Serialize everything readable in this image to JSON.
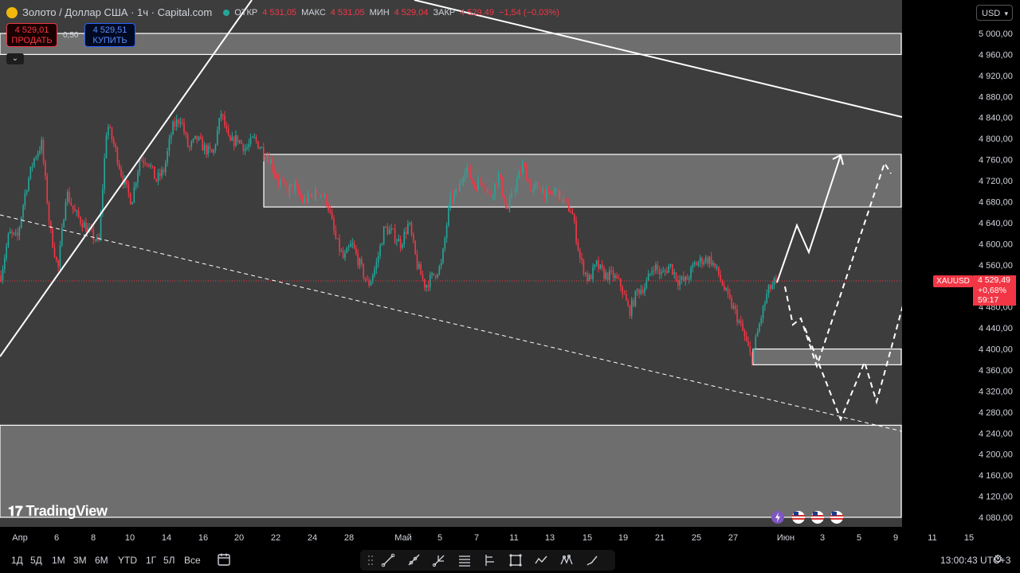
{
  "header": {
    "symbol_title": "Золото / Доллар США · 1ч · Capital.com",
    "open_label": "ОТКР",
    "open_value": "4 531,05",
    "high_label": "МАКС",
    "high_value": "4 531,05",
    "low_label": "МИН",
    "low_value": "4 529,04",
    "close_label": "ЗАКР",
    "close_value": "4 529,49",
    "change": "−1,54 (−0,03%)"
  },
  "trade": {
    "sell_price": "4 529,01",
    "sell_label": "ПРОДАТЬ",
    "spread": "0,50",
    "buy_price": "4 529,51",
    "buy_label": "КУПИТЬ"
  },
  "currency": "USD",
  "ticker_tag": "XAUUSD",
  "price_label": {
    "price": "4 529,49",
    "change_pct": "+0,68%",
    "countdown": "59:17"
  },
  "brand": "TradingView",
  "ranges": [
    "1Д",
    "5Д",
    "1М",
    "3М",
    "6М",
    "YTD",
    "1Г",
    "5Л",
    "Все"
  ],
  "clock": "13:00:43 UTC+3",
  "colors": {
    "up": "#26a69a",
    "down": "#f23645",
    "background": "#3d3d3d",
    "zone": "#6e6e6e"
  },
  "icons": [
    "gold-icon",
    "chevron-down-icon",
    "calendar-range-icon",
    "trendline-icon",
    "ray-icon",
    "pitchfork-icon",
    "fib-icon",
    "long-position-icon",
    "rectangle-icon",
    "path-icon",
    "pattern-icon",
    "brush-icon",
    "lightning-icon",
    "us-flag-icon",
    "gear-icon"
  ],
  "chart_data": {
    "type": "candlestick",
    "symbol": "XAUUSD",
    "timeframe": "1ч",
    "last_price": 4529.49,
    "ylim": [
      4060,
      5020
    ],
    "y_ticks": [
      5000,
      4960,
      4920,
      4880,
      4840,
      4800,
      4760,
      4720,
      4680,
      4640,
      4600,
      4560,
      4520,
      4480,
      4440,
      4400,
      4360,
      4320,
      4280,
      4240,
      4200,
      4160,
      4120,
      4080
    ],
    "y_tick_labels": [
      "5 000,00",
      "4 960,00",
      "4 920,00",
      "4 880,00",
      "4 840,00",
      "4 800,00",
      "4 760,00",
      "4 720,00",
      "4 680,00",
      "4 640,00",
      "4 600,00",
      "4 560,00",
      "",
      "4 480,00",
      "4 440,00",
      "4 400,00",
      "4 360,00",
      "4 320,00",
      "4 280,00",
      "4 240,00",
      "4 200,00",
      "4 160,00",
      "4 120,00",
      "4 080,00"
    ],
    "x_tick_labels": [
      "Апр",
      "6",
      "8",
      "10",
      "14",
      "16",
      "20",
      "22",
      "24",
      "28",
      "Май",
      "5",
      "7",
      "11",
      "13",
      "15",
      "19",
      "21",
      "25",
      "27",
      "Июн",
      "3",
      "5",
      "9",
      "11",
      "15"
    ],
    "price_path": [
      [
        4540,
        4620,
        4610,
        4700,
        4760,
        4790,
        4630,
        4550,
        4700,
        4660,
        4640,
        4620,
        4600,
        4830,
        4780,
        4720,
        4680,
        4760,
        4760,
        4720,
        4740,
        4820,
        4840,
        4780,
        4800,
        4780,
        4770,
        4850,
        4790,
        4800,
        4780,
        4800
      ],
      [
        4780,
        4760,
        4720,
        4700,
        4710,
        4680,
        4690,
        4700,
        4680,
        4610,
        4570,
        4600,
        4560,
        4520,
        4560,
        4630,
        4620,
        4600,
        4640,
        4560,
        4520,
        4540,
        4560,
        4680,
        4700,
        4750,
        4710,
        4720,
        4690,
        4730,
        4660,
        4710
      ],
      [
        4750,
        4700,
        4710,
        4690,
        4700,
        4680,
        4660,
        4570,
        4530,
        4560,
        4540,
        4540,
        4520,
        4470,
        4510,
        4520,
        4560,
        4540,
        4560,
        4530,
        4530,
        4560,
        4570,
        4570,
        4540,
        4500,
        4470,
        4430,
        4380,
        4450,
        4510,
        4530
      ]
    ],
    "zones": [
      {
        "from": 4960,
        "to": 5000
      },
      {
        "from": 4670,
        "to": 4770
      },
      {
        "from": 4370,
        "to": 4400
      },
      {
        "from": 4080,
        "to": 4255
      }
    ],
    "current_price_line": 4529.49
  }
}
